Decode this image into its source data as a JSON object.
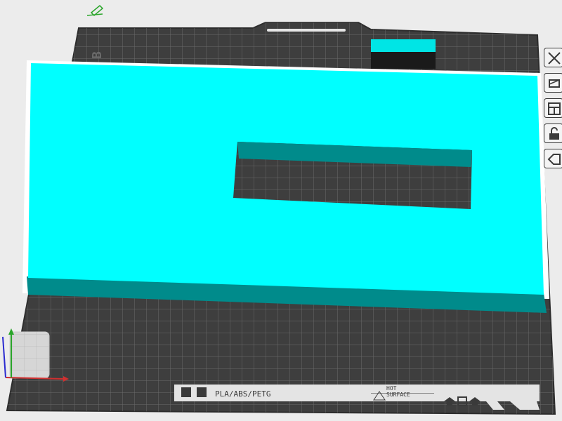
{
  "scene": {
    "view": "3d-build-plate",
    "object_color": "#00ffff",
    "object_side_color": "#008b8b",
    "object_outline_color": "#ffffff",
    "bed_color": "#3e3e3e",
    "bed_grid_color": "#6a6a6a",
    "background_color": "#ececec"
  },
  "bed": {
    "corner_text": "B",
    "filament_label": "PLA/ABS/PETG",
    "hot_surface_line1": "HOT",
    "hot_surface_line2": "SURFACE"
  },
  "toolbar": {
    "tools": [
      {
        "name": "close-icon",
        "state": "default"
      },
      {
        "name": "reslice-icon",
        "state": "default"
      },
      {
        "name": "arrange-icon",
        "state": "default"
      },
      {
        "name": "lock-icon",
        "state": "default"
      },
      {
        "name": "erase-icon",
        "state": "default"
      }
    ]
  },
  "axes": {
    "x_color": "#d03030",
    "y_color": "#2aa52a",
    "z_color": "#2a2ad0"
  }
}
